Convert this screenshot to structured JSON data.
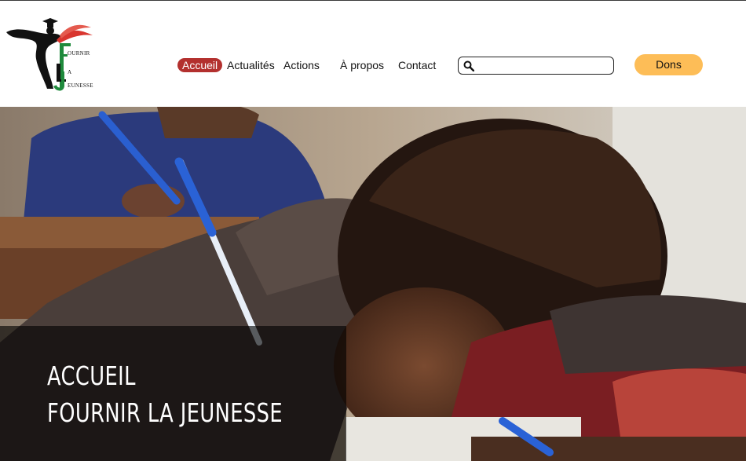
{
  "logo": {
    "icon": "graduate-ribbon-logo",
    "line1": "OURNIR",
    "line2": "A",
    "line3": "EUNESSE",
    "colors": {
      "green": "#1f8a3c",
      "red": "#d9362f",
      "black": "#111111"
    }
  },
  "nav": {
    "items": [
      {
        "label": "Accueil",
        "active": true
      },
      {
        "label": "Actualités",
        "active": false
      },
      {
        "label": "Actions",
        "active": false
      },
      {
        "label": "À propos",
        "active": false
      },
      {
        "label": "Contact",
        "active": false
      }
    ],
    "active_color": "#b3302e"
  },
  "search": {
    "icon": "search-icon",
    "value": "",
    "placeholder": ""
  },
  "donate": {
    "label": "Dons",
    "color": "#fdbd57"
  },
  "hero": {
    "image": "child-writing-in-classroom",
    "title_line1": "ACCUEIL",
    "title_line2": "FOURNIR LA JEUNESSE"
  }
}
